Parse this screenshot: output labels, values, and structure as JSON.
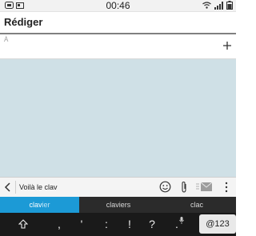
{
  "status_bar": {
    "time": "00:46",
    "icons": [
      "bbm-icon",
      "sim-icon",
      "wifi-icon",
      "signal-icon",
      "battery-icon"
    ]
  },
  "header": {
    "title": "Rédiger"
  },
  "recipient": {
    "label": "À",
    "add_icon": "plus-icon"
  },
  "compose": {
    "text": "Voilà le clav",
    "icons": [
      "back-chevron-icon",
      "emoji-icon",
      "paperclip-icon",
      "send-icon",
      "more-icon"
    ]
  },
  "keyboard": {
    "suggestions": [
      {
        "typed": "clav",
        "rest": "ier",
        "selected": true
      },
      {
        "text": "claviers",
        "selected": false
      },
      {
        "text": "clac",
        "selected": false
      }
    ],
    "keys": [
      ",",
      "'",
      ":",
      "!",
      "?",
      "."
    ],
    "shift_icon": "shift-icon",
    "mic_icon": "microphone-icon",
    "symbol_key": "@123"
  },
  "colors": {
    "accent": "#1c9ad6",
    "conversation_bg": "#cfe0e6",
    "keyboard_bg": "#1a1a1a"
  }
}
